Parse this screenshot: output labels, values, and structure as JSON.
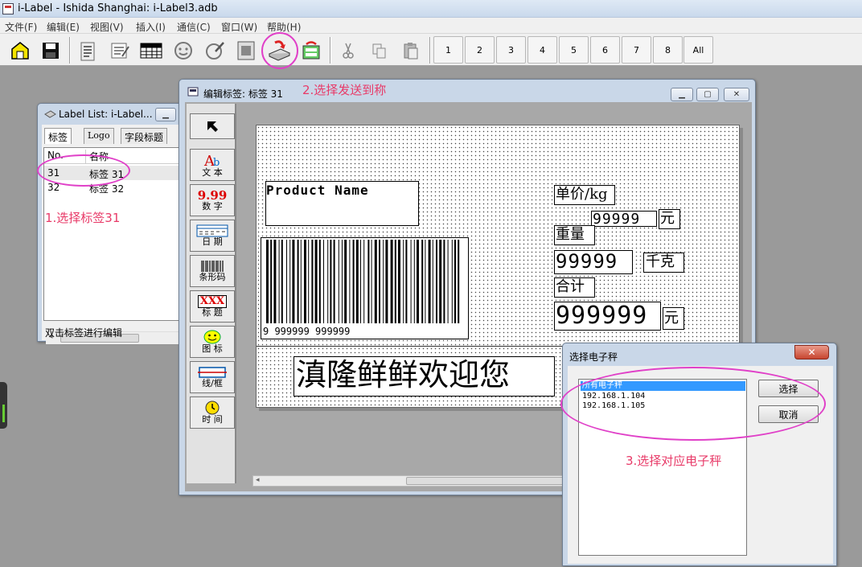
{
  "app": {
    "title": "i-Label - Ishida Shanghai: i-Label3.adb"
  },
  "menu": [
    "文件(F)",
    "编辑(E)",
    "视图(V)",
    "插入(I)",
    "通信(C)",
    "窗口(W)",
    "帮助(H)"
  ],
  "toolbar": {
    "icons": [
      "open-folder",
      "save",
      "label-settings",
      "edit-table",
      "grid-table",
      "scale-connect",
      "edit-check",
      "template",
      "send-to-scale",
      "receive-from-scale",
      "cut",
      "copy",
      "paste"
    ],
    "numbers": [
      "1",
      "2",
      "3",
      "4",
      "5",
      "6",
      "7",
      "8",
      "All"
    ]
  },
  "label_list": {
    "title": "Label List: i-Label...",
    "tabs": [
      "标签",
      "Logo",
      "字段标题"
    ],
    "columns": [
      "No.",
      "名称"
    ],
    "rows": [
      {
        "no": "31",
        "name": "标签 31"
      },
      {
        "no": "32",
        "name": "标签 32"
      }
    ],
    "status": "双击标签进行编辑"
  },
  "editor": {
    "title": "编辑标签: 标签 31",
    "palette": [
      "文 本",
      "数 字",
      "日 期",
      "条形码",
      "标 题",
      "图 标",
      "线/框",
      "时 间"
    ],
    "palette_glyphs": {
      "number": "9.99",
      "title": "XXX"
    }
  },
  "label": {
    "product_name": "Product  Name",
    "barcode_text": "9 999999 999999",
    "unit_price_title": "单价/kg",
    "unit_price_value": "99999",
    "yuan": "元",
    "weight_title": "重量",
    "weight_value": "99999",
    "kg": "千克",
    "total_title": "合计",
    "total_value": "999999",
    "footer_text": "滇隆鲜鲜欢迎您"
  },
  "scale_dialog": {
    "title": "选择电子秤",
    "options": [
      "所有电子秤",
      "192.168.1.104",
      "192.168.1.105"
    ],
    "selected_index": 0,
    "ok_label": "选择",
    "cancel_label": "取消"
  },
  "annotations": {
    "step1": "1.选择标签31",
    "step2": "2.选择发送到称",
    "step3": "3.选择对应电子秤"
  },
  "colors": {
    "annotation": "#e83a68",
    "ring": "#e040c8",
    "selection": "#3399ff"
  }
}
